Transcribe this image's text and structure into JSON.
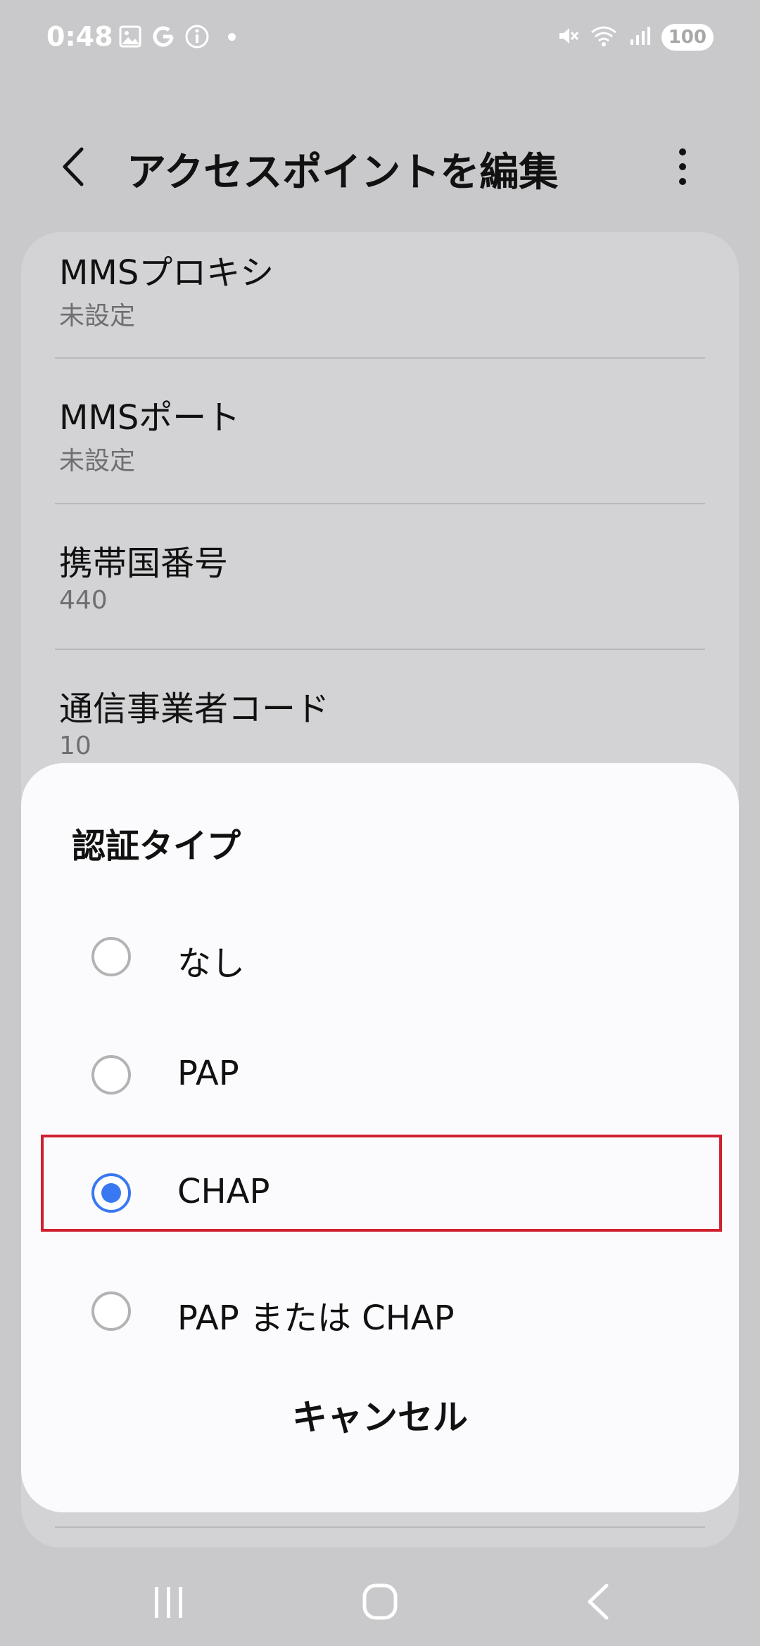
{
  "status_bar": {
    "time": "0:48",
    "left_icons": [
      "gallery-icon",
      "google-icon",
      "info-icon",
      "dot"
    ],
    "right_icons": [
      "mute-icon",
      "wifi-icon",
      "signal-icon"
    ],
    "battery": "100"
  },
  "header": {
    "title": "アクセスポイントを編集"
  },
  "settings": {
    "items": [
      {
        "title": "MMSプロキシ",
        "value": "未設定"
      },
      {
        "title": "MMSポート",
        "value": "未設定"
      },
      {
        "title": "携帯国番号",
        "value": "440"
      },
      {
        "title": "通信事業者コード",
        "value": "10"
      }
    ]
  },
  "dialog": {
    "title": "認証タイプ",
    "options": [
      {
        "label": "なし",
        "selected": false
      },
      {
        "label": "PAP",
        "selected": false
      },
      {
        "label": "CHAP",
        "selected": true
      },
      {
        "label": "PAP または CHAP",
        "selected": false
      }
    ],
    "cancel_label": "キャンセル"
  },
  "colors": {
    "accent": "#3a78f2",
    "highlight": "#d02030"
  }
}
